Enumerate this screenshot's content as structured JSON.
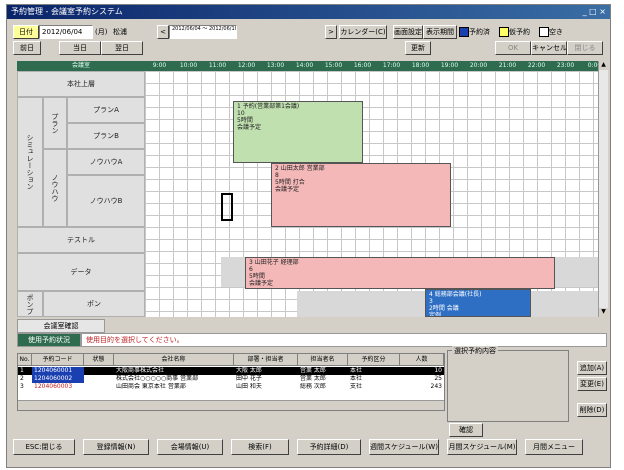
{
  "window": {
    "title": "予約管理 - 会議室予約システム",
    "controls": "_ □ ×"
  },
  "toolbar": {
    "date_button": "日付",
    "date_value": "2012/06/04",
    "weekday": "(月)",
    "weekday_extra": "松浦",
    "prev_week": "<",
    "range_text": "2012/06/04 〜 2012/06/10",
    "next_week": ">",
    "calendar_button": "カレンダー(C)",
    "today_label": "前日",
    "today2_label": "当日",
    "next_label": "翌日",
    "display_setting": "画面設定",
    "period_setting": "表示期間",
    "right_btn_1": "OK",
    "right_btn_2": "キャンセル",
    "right_btn_3": "閉じる",
    "legend_1": "予約済",
    "legend_2": "仮予約",
    "legend_3": "空き",
    "legend_color_1": "#1a3fb0",
    "legend_color_2": "#ffff66",
    "legend_color_3": "#ffffff",
    "small_btn": "更新"
  },
  "schedule": {
    "header_label": "会議室",
    "time_header": [
      "9:00",
      "10:00",
      "11:00",
      "12:00",
      "13:00",
      "14:00",
      "15:00",
      "16:00",
      "17:00",
      "18:00",
      "19:00",
      "20:00",
      "21:00",
      "22:00",
      "23:00",
      "0:00",
      "1:00",
      "2:00",
      "3:00",
      "4:00"
    ],
    "group_labels": [
      "シミュレーション",
      "プラン",
      "ノウハウ",
      "ポンプ"
    ],
    "rows": [
      {
        "name": "本社上層"
      },
      {
        "name": "プランA"
      },
      {
        "name": "プランB"
      },
      {
        "name": "ノウハウA"
      },
      {
        "name": "ノウハウB"
      },
      {
        "name": "テストル"
      },
      {
        "name": "データ"
      },
      {
        "name": "ポン"
      }
    ],
    "reservations": [
      {
        "text": "1 予約(営業部第1会議)\n10\n5時間\n会議予定",
        "color": "#c0e0b0"
      },
      {
        "text": "2 山田太郎 営業部\n8\n5時間 打合\n会議予定",
        "color": "#f4b8b8"
      },
      {
        "text": "3 山田花子 経理部\n6\n5時間\n会議予定",
        "color": "#f4b8b8"
      },
      {
        "text": "4 総務部会議(社長)\n3\n2時間 会議\n定例",
        "color": "#2e6fc4"
      }
    ]
  },
  "status": {
    "label_1": "会議室確認",
    "label_2": "使用予約状況",
    "message": "使用目的を選択してください。"
  },
  "list": {
    "columns": [
      "No.",
      "予約コード",
      "状態",
      "会社名称",
      "部署・担当者",
      "担当者名",
      "予約区分",
      "人数"
    ],
    "rows": [
      {
        "no": "1",
        "code": "1204060001",
        "status": "",
        "company": "大阪商事株式会社",
        "dept": "大阪 太郎",
        "person": "営業 太郎",
        "kind": "本社",
        "count": "10"
      },
      {
        "no": "2",
        "code": "1204060002",
        "status": "",
        "company": "株式会社○○○○○商事 営業部",
        "dept": "田中 花子",
        "person": "営業 太郎",
        "kind": "本社",
        "count": "25"
      },
      {
        "no": "3",
        "code": "1204060003",
        "status": "",
        "company": "山田商会 東京本社 営業部",
        "dept": "山田 和夫",
        "person": "総務 次郎",
        "kind": "支社",
        "count": "243"
      }
    ]
  },
  "details": {
    "group_title": "選択予約内容",
    "side_btn_1": "追加(A)",
    "side_btn_2": "変更(E)",
    "side_btn_3": "削除(D)",
    "confirm_btn": "確認"
  },
  "footer": {
    "buttons": [
      "ESC:閉じる",
      "登録情報(N)",
      "会場情報(U)",
      "検索(F)",
      "予約詳細(D)",
      "週間スケジュール(W)",
      "月間スケジュール(M)",
      "月間メニュー"
    ]
  }
}
